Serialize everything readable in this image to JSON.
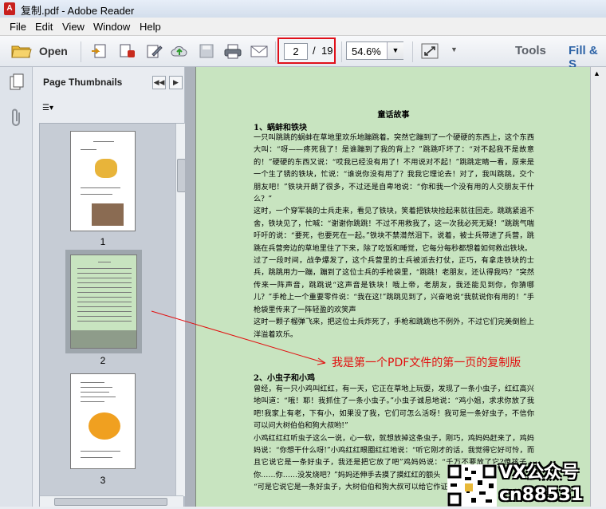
{
  "window": {
    "title": "复制.pdf - Adobe Reader",
    "app_icon_text": "A"
  },
  "menu": [
    "File",
    "Edit",
    "View",
    "Window",
    "Help"
  ],
  "toolbar": {
    "open_label": "Open",
    "current_page": "2",
    "page_separator": "/",
    "total_pages": "19",
    "zoom": "54.6%",
    "tools_label": "Tools",
    "fill_sign_label": "Fill & S"
  },
  "panel": {
    "title": "Page Thumbnails",
    "thumbnails": [
      {
        "number": "1"
      },
      {
        "number": "2",
        "selected": true
      },
      {
        "number": "3"
      }
    ]
  },
  "document": {
    "title": "童话故事",
    "section1_heading": "1、蜗蚌和铁块",
    "section1_text": "一只叫跳跳的蜗蚌在草地里欢乐地蹦跳着。突然它蹦到了一个硬硬的东西上，这个东西大叫：“呀——疼死我了！是谁蹦到了我的背上？”跳跳吓坏了：“对不起我不是故意的！”硬硬的东西又说：“哎我已经没有用了！不用说对不起！”跳跳定睛一看，原来是一个生了锈的铁块，忙说：“谁说你没有用了？我我它理论去！对了，我叫跳跳，交个朋友吧！”铁块开朗了很多，不过还是自卑地说：“你和我一个没有用的人交朋友干什么？”\n这时，一个穿军装的士兵走来，看见了铁块，笑着把铁块捡起来就往回走。跳跳紧追不舍，铁块见了，忙喊：“谢谢你跳跳！不过不用救我了，这一次我必死无疑！”跳跳气喘吁吁的说：“要死，也要死在一起。”铁块不禁潸然泪下。说着，被士兵带进了兵营，跳跳在兵营旁边的草地里住了下来，除了吃饭和睡觉，它每分每秒都想着如何救出铁块。\n过了一段时间，战争爆发了，这个兵营里的士兵被派去打仗，正巧，有拿走铁块的士兵，跳跳用力一蹦，蹦到了这位士兵的手枪袋里，“跳跳！老朋友，还认得我吗？”突然传来一阵声音，跳跳说“这声音是铁块！哦上帝，老朋友，我还能见到你，你猜哪儿？”手枪上一个重要零件说：“我在这!”跳跳见到了，兴奋地说“我就说你有用的！”手枪袋里传来了一阵轻盈的欢笑声\n这时一颗子榴弹飞来，把这位士兵炸死了，手枪和跳跳也不例外，不过它们完美倒脸上洋溢着欢乐。",
    "section2_heading": "2、小虫子和小鸡",
    "section2_text": "曾经，有一只小鸡叫红红，有一天，它正在草地上玩耍，发现了一条小虫子，红红高兴地叫道：“哦！耶！我抓住了一条小虫子。”小虫子诚恳地说：“鸡小姐，求求你放了我吧!我家上有老，下有小，如果没了我，它们可怎么活呀！我可是一条好虫子，不信你可以问大树伯伯和狗大叔哟!”\n小鸡红红红听虫子这么一说，心一软，就想放掉这条虫子，刚巧，鸡妈妈赶来了，鸡妈妈说：“你想干什么呀!”小鸡红红眼圈红红地说：“听它刚才的话，我觉得它好可怜，而且它说它是一条好虫子，我还是把它放了吧”鸡妈妈说：“千万不要放了它?傻孩子，你……你……没发烧吧？”妈妈还伸手去摸了摸红红的额头\n“可是它说它是一条好虫子，大树伯伯和狗大叔可以给它作证。”"
  },
  "annotation": {
    "text": "我是第一个PDF文件的第一页的复制版",
    "color": "#e20f0f"
  },
  "watermark": {
    "line1": "VX公众号",
    "line2": "cn88531"
  }
}
